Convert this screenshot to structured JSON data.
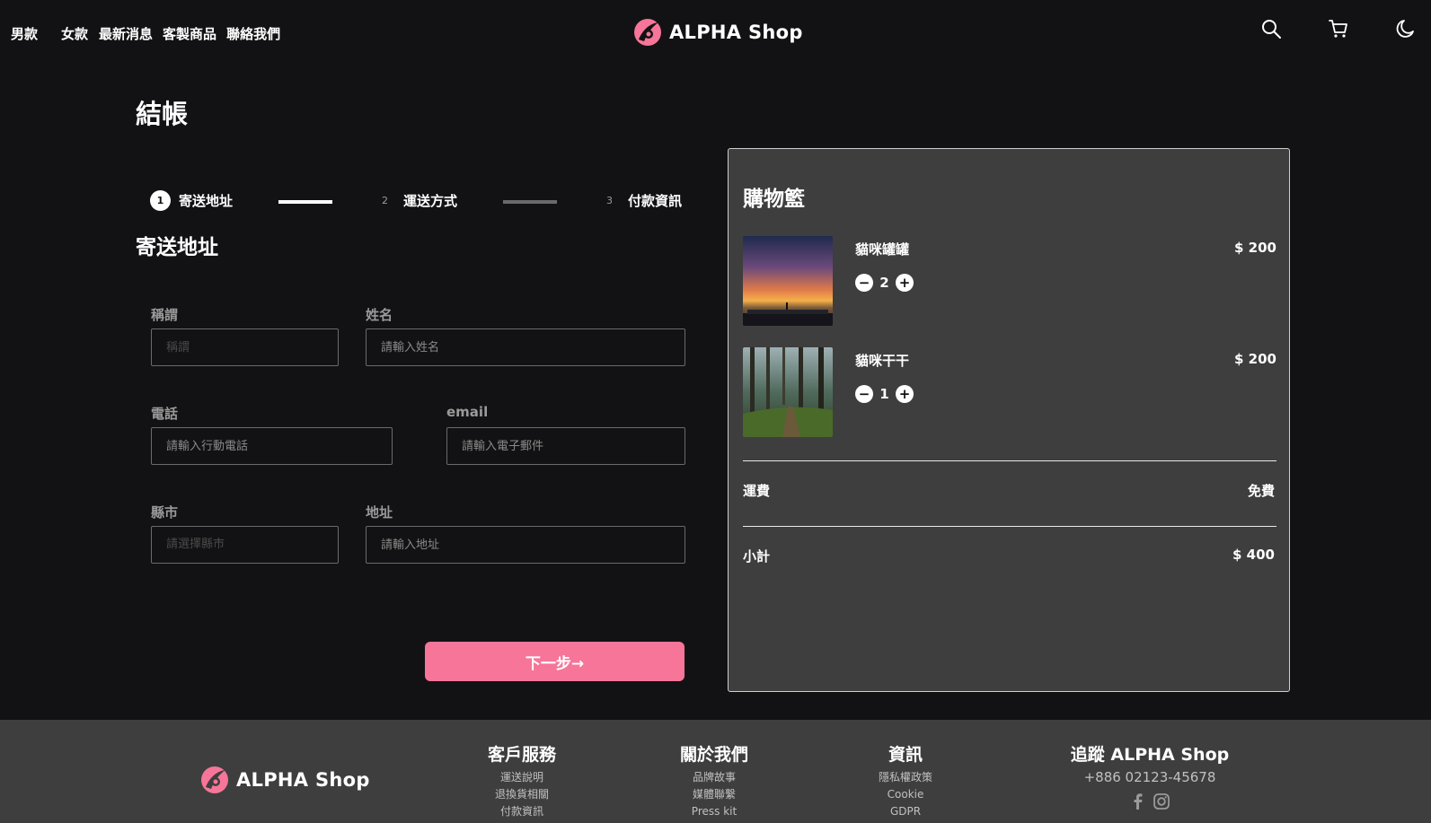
{
  "header": {
    "nav": [
      "男款",
      "女款",
      "最新消息",
      "客製商品",
      "聯絡我們"
    ],
    "brand": "ALPHA Shop",
    "icons": [
      "search-icon",
      "cart-icon",
      "moon-icon"
    ]
  },
  "page_title": "結帳",
  "stepper": {
    "steps": [
      {
        "num": "1",
        "label": "寄送地址",
        "state": "active"
      },
      {
        "num": "2",
        "label": "運送方式",
        "state": "idle"
      },
      {
        "num": "3",
        "label": "付款資訊",
        "state": "idle"
      }
    ]
  },
  "form": {
    "title": "寄送地址",
    "salutation": {
      "label": "稱謂",
      "placeholder": "稱謂"
    },
    "name": {
      "label": "姓名",
      "placeholder": "請輸入姓名"
    },
    "phone": {
      "label": "電話",
      "placeholder": "請輸入行動電話"
    },
    "email": {
      "label": "email",
      "placeholder": "請輸入電子郵件"
    },
    "city": {
      "label": "縣市",
      "placeholder": "請選擇縣市"
    },
    "address": {
      "label": "地址",
      "placeholder": "請輸入地址"
    },
    "next_label": "下一步→"
  },
  "cart": {
    "title": "購物籃",
    "items": [
      {
        "name": "貓咪罐罐",
        "price": "$ 200",
        "qty": "2"
      },
      {
        "name": "貓咪干干",
        "price": "$ 200",
        "qty": "1"
      }
    ],
    "shipping_label": "運費",
    "shipping_value": "免費",
    "subtotal_label": "小計",
    "subtotal_value": "$ 400"
  },
  "footer": {
    "brand": "ALPHA Shop",
    "columns": [
      {
        "title": "客戶服務",
        "links": [
          "運送說明",
          "退換貨相關",
          "付款資訊"
        ]
      },
      {
        "title": "關於我們",
        "links": [
          "品牌故事",
          "媒體聯繫",
          "Press kit"
        ]
      },
      {
        "title": "資訊",
        "links": [
          "隱私權政策",
          "Cookie",
          "GDPR"
        ]
      }
    ],
    "follow_title": "追蹤 ALPHA Shop",
    "phone": "+886 02123-45678"
  },
  "colors": {
    "background": "#121214",
    "panel": "#3e3e3e",
    "accent": "#f67599"
  }
}
